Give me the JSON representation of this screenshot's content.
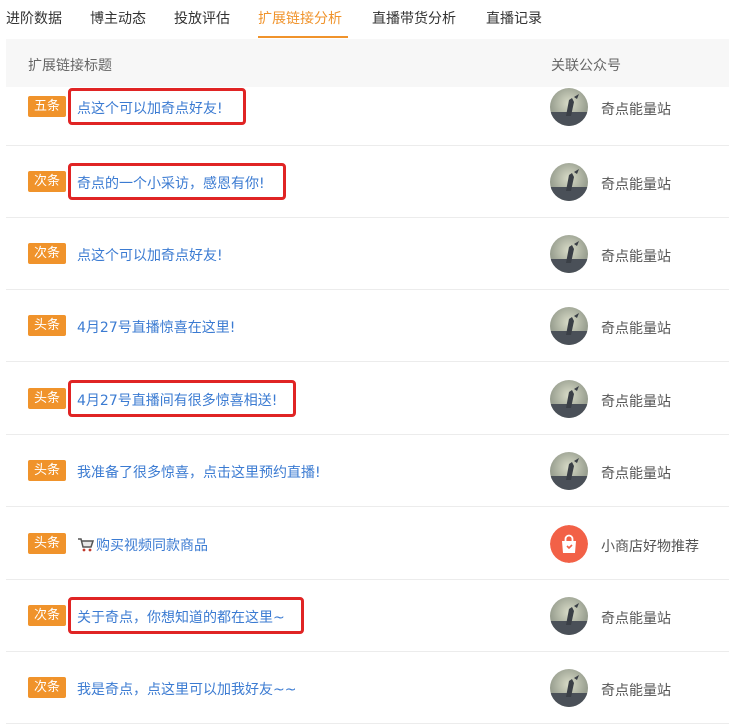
{
  "tabs": [
    {
      "label": "进阶数据",
      "active": false
    },
    {
      "label": "博主动态",
      "active": false
    },
    {
      "label": "投放评估",
      "active": false
    },
    {
      "label": "扩展链接分析",
      "active": true
    },
    {
      "label": "直播带货分析",
      "active": false
    },
    {
      "label": "直播记录",
      "active": false
    }
  ],
  "table": {
    "col_title": "扩展链接标题",
    "col_account": "关联公众号",
    "rows": [
      {
        "badge": "五条",
        "title": "点这个可以加奇点好友!",
        "account": "奇点能量站",
        "avatar": "photo-avatar",
        "highlighted": true
      },
      {
        "badge": "次条",
        "title": "奇点的一个小采访，感恩有你!",
        "account": "奇点能量站",
        "avatar": "photo-avatar",
        "highlighted": true
      },
      {
        "badge": "次条",
        "title": "点这个可以加奇点好友!",
        "account": "奇点能量站",
        "avatar": "photo-avatar",
        "highlighted": false
      },
      {
        "badge": "头条",
        "title": "4月27号直播惊喜在这里!",
        "account": "奇点能量站",
        "avatar": "photo-avatar",
        "highlighted": false
      },
      {
        "badge": "头条",
        "title": "4月27号直播间有很多惊喜相送!",
        "account": "奇点能量站",
        "avatar": "photo-avatar",
        "highlighted": true
      },
      {
        "badge": "头条",
        "title": "我准备了很多惊喜，点击这里预约直播!",
        "account": "奇点能量站",
        "avatar": "photo-avatar",
        "highlighted": false
      },
      {
        "badge": "头条",
        "title": "购买视频同款商品",
        "icon": "shopping-cart-icon",
        "account": "小商店好物推荐",
        "avatar": "shop-bag-icon",
        "highlighted": false
      },
      {
        "badge": "次条",
        "title": "关于奇点，你想知道的都在这里~",
        "account": "奇点能量站",
        "avatar": "photo-avatar",
        "highlighted": true
      },
      {
        "badge": "次条",
        "title": "我是奇点，点这里可以加我好友~~",
        "account": "奇点能量站",
        "avatar": "photo-avatar",
        "highlighted": false
      }
    ]
  },
  "colors": {
    "accent": "#f0932b",
    "link": "#3b7bd2",
    "highlight_border": "#e02424",
    "shop_icon_bg": "#f26147"
  }
}
